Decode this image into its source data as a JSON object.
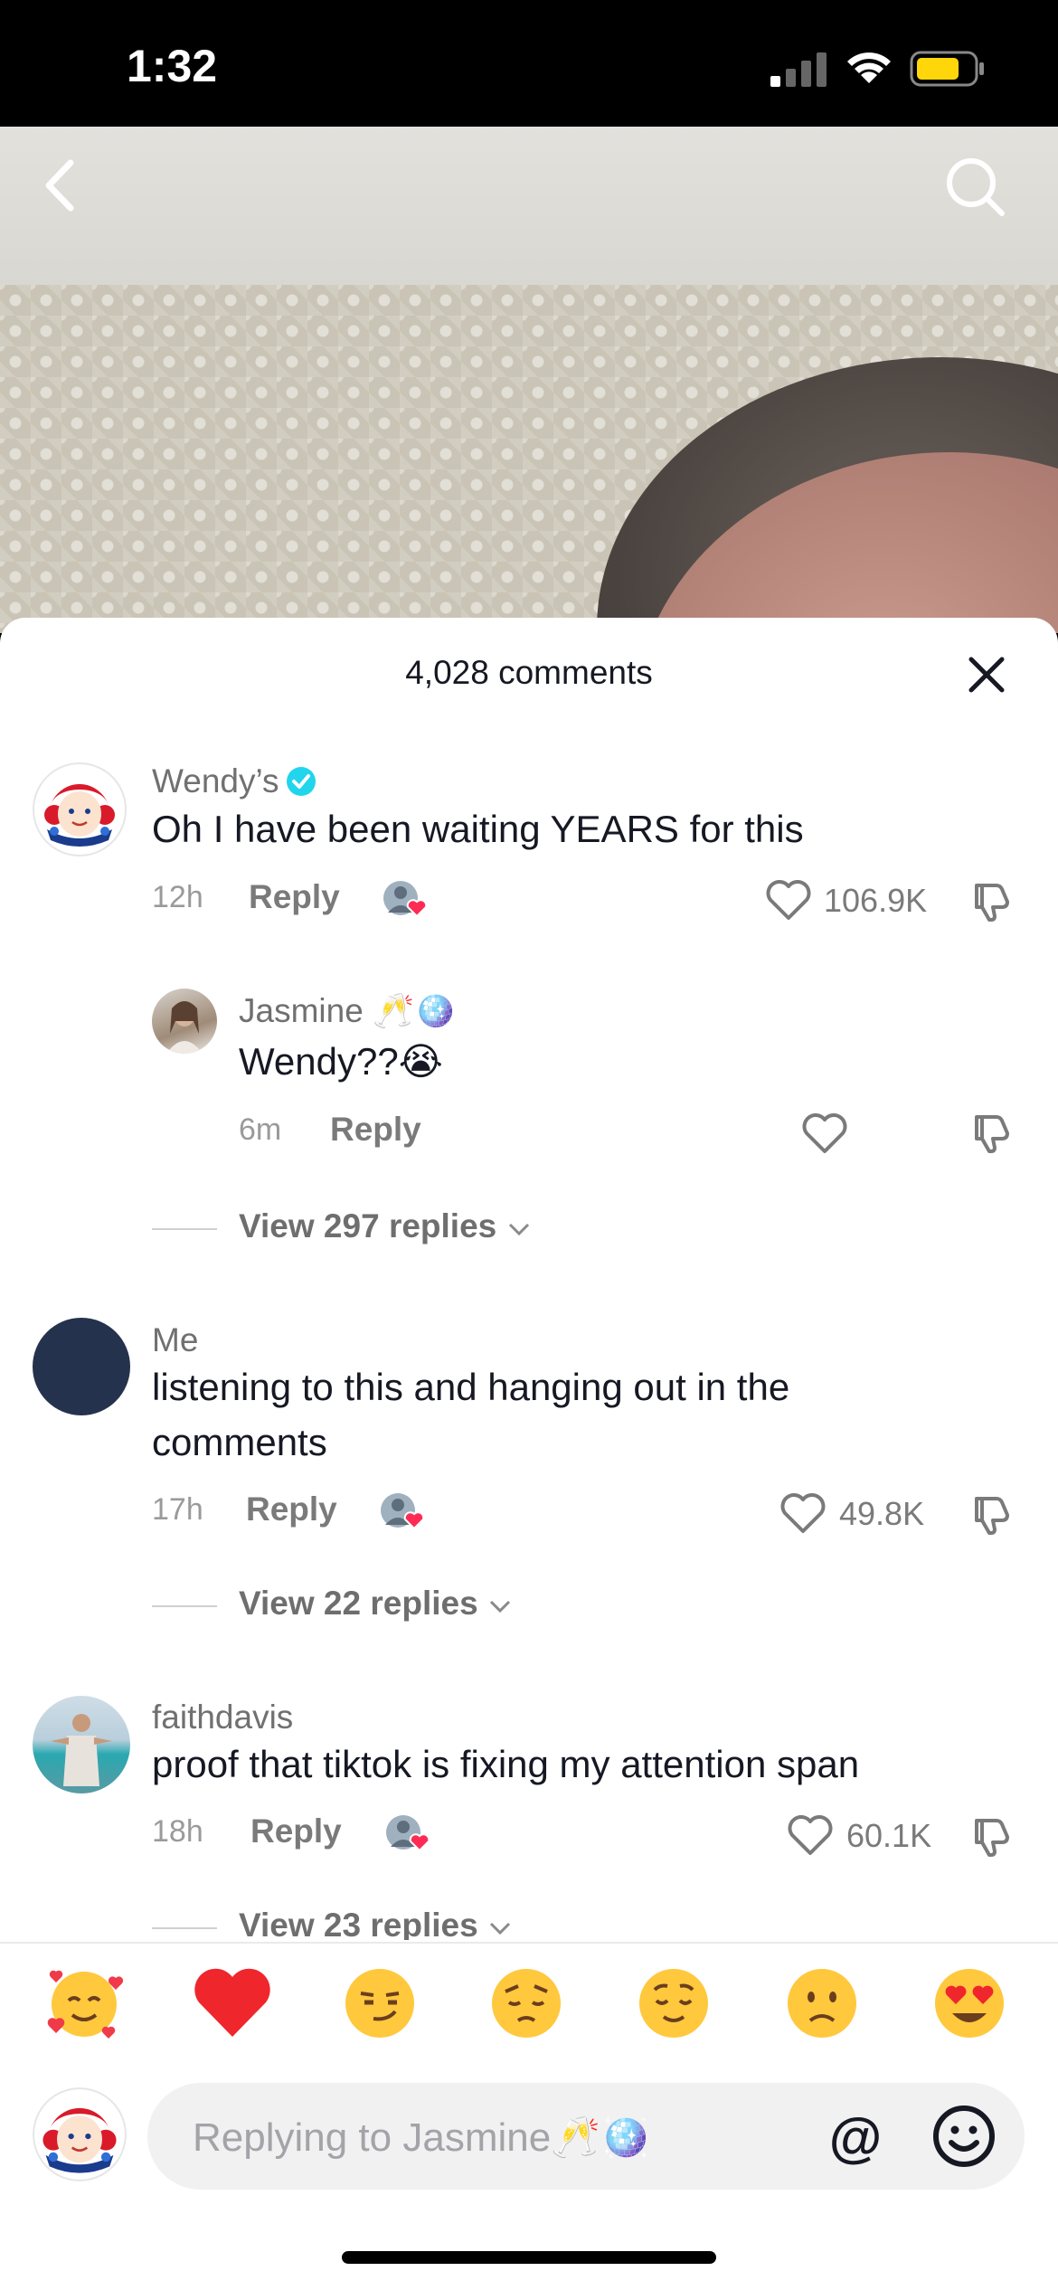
{
  "status_bar": {
    "time": "1:32"
  },
  "header": {
    "comments_count_label": "4,028 comments"
  },
  "comments": [
    {
      "username": "Wendy’s",
      "verified": true,
      "text": "Oh I have been waiting YEARS for this",
      "time": "12h",
      "reply_label": "Reply",
      "likes": "106.9K",
      "replies": [
        {
          "username": "Jasmine",
          "username_emojis": "🥂🪩",
          "text": "Wendy??",
          "text_emoji": "😭",
          "time": "6m",
          "reply_label": "Reply"
        }
      ],
      "view_replies_label": "View 297 replies"
    },
    {
      "username": "Me",
      "text": "listening to this and hanging out in the comments",
      "time": "17h",
      "reply_label": "Reply",
      "likes": "49.8K",
      "view_replies_label": "View 22 replies"
    },
    {
      "username": "faithdavis",
      "text": "proof that tiktok is fixing my attention span",
      "time": "18h",
      "reply_label": "Reply",
      "likes": "60.1K",
      "view_replies_label": "View 23 replies"
    }
  ],
  "emoji_bar": [
    "🥰",
    "❤️",
    "😏",
    "😔",
    "😌",
    "☹️",
    "😍"
  ],
  "composer": {
    "placeholder": "Replying to Jasmine🥂🪩",
    "at_symbol": "@"
  },
  "colors": {
    "verified": "#20d5ec",
    "heart_badge": "#fe2c55",
    "text_primary": "#161823",
    "me_avatar": "#24324d"
  }
}
